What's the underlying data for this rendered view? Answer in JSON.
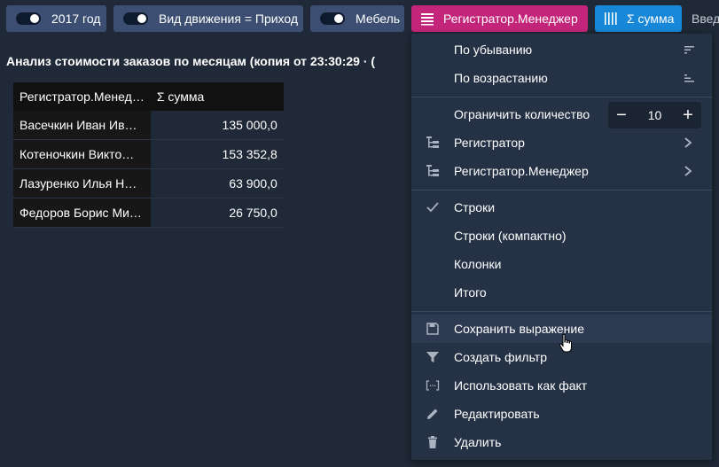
{
  "filters": [
    {
      "label": "2017 год"
    },
    {
      "label": "Вид движения = Приход"
    },
    {
      "label": "Мебель"
    }
  ],
  "dimension_chip": {
    "label": "Регистратор.Менеджер",
    "color": "#c3257a"
  },
  "measure_chip": {
    "label": "Σ сумма",
    "color": "#1787d8"
  },
  "intro_text": "Введ",
  "report_title": "Анализ стоимости заказов по месяцам (копия от 23:30:29 · (",
  "table": {
    "headers": [
      "Регистратор.Менед…",
      "Σ сумма"
    ],
    "rows": [
      {
        "name": "Васечкин Иван Ив…",
        "value": "135 000,0"
      },
      {
        "name": "Котеночкин Викто…",
        "value": "153 352,8"
      },
      {
        "name": "Лазуренко Илья Н…",
        "value": "63 900,0"
      },
      {
        "name": "Федоров Борис Ми…",
        "value": "26 750,0"
      }
    ]
  },
  "menu": {
    "sort_desc": "По убыванию",
    "sort_asc": "По возрастанию",
    "limit_label": "Ограничить количество",
    "limit_value": "10",
    "limit_minus": "−",
    "limit_plus": "+",
    "group_registrator": "Регистратор",
    "group_manager": "Регистратор.Менеджер",
    "view_rows": "Строки",
    "view_rows_compact": "Строки (компактно)",
    "view_columns": "Колонки",
    "view_totals": "Итого",
    "save_expression": "Сохранить выражение",
    "create_filter": "Создать фильтр",
    "use_as_fact": "Использовать как факт",
    "edit": "Редактировать",
    "delete": "Удалить"
  }
}
